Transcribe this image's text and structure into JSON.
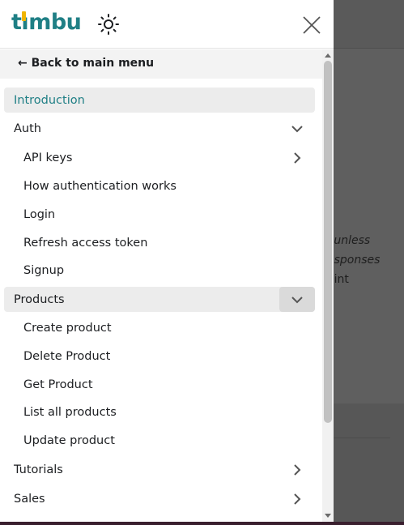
{
  "brand": {
    "logo_text_left": "t",
    "logo_text_i": "ı",
    "logo_text_right": "mbu"
  },
  "header": {
    "close_label": "Close menu",
    "theme_label": "Toggle theme"
  },
  "back_link": "← Back to main menu",
  "menu": {
    "introduction": "Introduction",
    "auth": "Auth",
    "auth_items": {
      "api_keys": "API keys",
      "how_auth": "How authentication works",
      "login": "Login",
      "refresh": "Refresh access token",
      "signup": "Signup"
    },
    "products": "Products",
    "product_items": {
      "create": "Create product",
      "delete": "Delete Product",
      "get": "Get Product",
      "list": "List all products",
      "update": "Update product"
    },
    "tutorials": "Tutorials",
    "sales": "Sales"
  },
  "background_text": {
    "line1": "l unless",
    "line2": "esponses",
    "line3": "oint"
  },
  "colors": {
    "brand": "#1f7f85",
    "accent_i": "#f0b400",
    "active_bg": "#ececec"
  }
}
